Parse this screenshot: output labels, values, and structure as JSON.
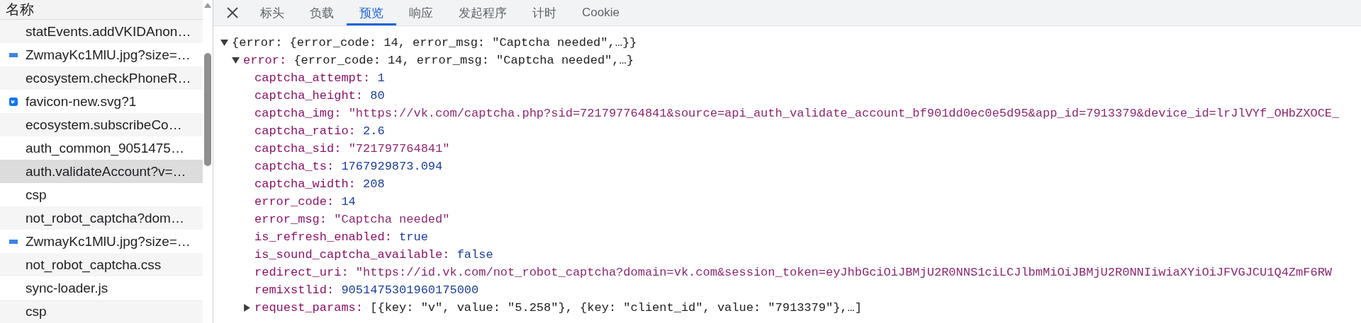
{
  "sidebar": {
    "header": "名称",
    "rows": [
      {
        "name": "statEvents.addVKIDAnon…",
        "kind": "plain",
        "selected": false
      },
      {
        "name": "ZwmayKc1MlU.jpg?size=…",
        "kind": "image",
        "selected": false
      },
      {
        "name": "ecosystem.checkPhoneR…",
        "kind": "plain",
        "selected": false
      },
      {
        "name": "favicon-new.svg?1",
        "kind": "site",
        "selected": false
      },
      {
        "name": "ecosystem.subscribeCo…",
        "kind": "plain",
        "selected": false
      },
      {
        "name": "auth_common_9051475…",
        "kind": "plain",
        "selected": false
      },
      {
        "name": "auth.validateAccount?v=…",
        "kind": "plain",
        "selected": true
      },
      {
        "name": "csp",
        "kind": "plain",
        "selected": false
      },
      {
        "name": "not_robot_captcha?dom…",
        "kind": "plain",
        "selected": false
      },
      {
        "name": "ZwmayKc1MlU.jpg?size=…",
        "kind": "image",
        "selected": false
      },
      {
        "name": "not_robot_captcha.css",
        "kind": "plain",
        "selected": false
      },
      {
        "name": "sync-loader.js",
        "kind": "plain",
        "selected": false
      },
      {
        "name": "csp",
        "kind": "plain",
        "selected": false
      }
    ]
  },
  "tabs": [
    {
      "label": "标头",
      "selected": false
    },
    {
      "label": "负载",
      "selected": false
    },
    {
      "label": "预览",
      "selected": true
    },
    {
      "label": "响应",
      "selected": false
    },
    {
      "label": "发起程序",
      "selected": false
    },
    {
      "label": "计时",
      "selected": false
    },
    {
      "label": "Cookie",
      "selected": false
    }
  ],
  "preview": {
    "root": {
      "kind": "object",
      "expanded": true,
      "value": "{error: {error_code: 14, error_msg: \"Captcha needed\",…}}",
      "children": [
        {
          "kind": "object",
          "key": "error:",
          "expanded": true,
          "value": "{error_code: 14, error_msg: \"Captcha needed\",…}",
          "children": [
            {
              "kind": "number",
              "key": "captcha_attempt:",
              "value": "1"
            },
            {
              "kind": "number",
              "key": "captcha_height:",
              "value": "80"
            },
            {
              "kind": "string",
              "key": "captcha_img:",
              "value": "\"https://vk.com/captcha.php?sid=721797764841&source=api_auth_validate_account_bf901dd0ec0e5d95&app_id=7913379&device_id=lrJlVYf_OHbZXOCE_"
            },
            {
              "kind": "number",
              "key": "captcha_ratio:",
              "value": "2.6"
            },
            {
              "kind": "string",
              "key": "captcha_sid:",
              "value": "\"721797764841\""
            },
            {
              "kind": "number",
              "key": "captcha_ts:",
              "value": "1767929873.094"
            },
            {
              "kind": "number",
              "key": "captcha_width:",
              "value": "208"
            },
            {
              "kind": "number",
              "key": "error_code:",
              "value": "14"
            },
            {
              "kind": "string",
              "key": "error_msg:",
              "value": "\"Captcha needed\""
            },
            {
              "kind": "boolean",
              "key": "is_refresh_enabled:",
              "value": "true"
            },
            {
              "kind": "boolean",
              "key": "is_sound_captcha_available:",
              "value": "false"
            },
            {
              "kind": "string",
              "key": "redirect_uri:",
              "value": "\"https://id.vk.com/not_robot_captcha?domain=vk.com&session_token=eyJhbGciOiJBMjU2R0NNS1ciLCJlbmMiOiJBMjU2R0NNIiwiaXYiOiJFVGJCU1Q4ZmF6RW"
            },
            {
              "kind": "number",
              "key": "remixstlid:",
              "value": "9051475301960175000"
            },
            {
              "kind": "object",
              "key": "request_params:",
              "expanded": false,
              "value": "[{key: \"v\", value: \"5.258\"}, {key: \"client_id\", value: \"7913379\"},…]"
            }
          ]
        }
      ]
    }
  }
}
